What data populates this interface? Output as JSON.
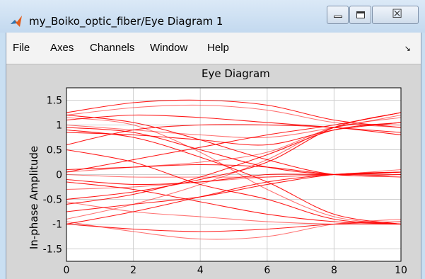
{
  "window": {
    "title": "my_Boiko_optic_fiber/Eye Diagram 1"
  },
  "icons": {
    "app": "matlab-logo-icon",
    "minimize": "minimize-icon",
    "maximize": "maximize-icon",
    "close": "close-icon",
    "dock": "dock-arrow-icon"
  },
  "controls": {
    "close_glyph": "☒"
  },
  "menu": {
    "items": [
      "File",
      "Axes",
      "Channels",
      "Window",
      "Help"
    ],
    "dock_glyph": "↘"
  },
  "chart_data": {
    "type": "line",
    "title": "Eye Diagram",
    "xlabel": "",
    "ylabel": "In-phase Amplitude",
    "xlim": [
      0,
      10
    ],
    "ylim": [
      -1.75,
      1.75
    ],
    "xticks": [
      "0",
      "2",
      "4",
      "6",
      "8",
      "10"
    ],
    "yticks": [
      "1.5",
      "1",
      "0.5",
      "0",
      "-0.5",
      "-1",
      "-1.5"
    ],
    "grid": true,
    "color": "#ff0000",
    "series": [
      {
        "x": [
          0,
          2,
          4,
          6,
          8,
          10
        ],
        "y": [
          1.2,
          1.35,
          1.4,
          1.3,
          1.05,
          0.95
        ]
      },
      {
        "x": [
          0,
          2,
          4,
          6,
          8,
          10
        ],
        "y": [
          1.25,
          1.45,
          1.5,
          1.4,
          1.1,
          0.95
        ]
      },
      {
        "x": [
          0,
          2,
          4,
          6,
          8,
          10
        ],
        "y": [
          1.1,
          1.2,
          1.15,
          1.05,
          0.95,
          0.85
        ]
      },
      {
        "x": [
          0,
          2,
          4,
          6,
          8,
          10
        ],
        "y": [
          1.0,
          0.9,
          0.8,
          0.75,
          0.95,
          1.2
        ]
      },
      {
        "x": [
          0,
          2,
          4,
          6,
          8,
          10
        ],
        "y": [
          0.95,
          0.85,
          0.5,
          0.15,
          0.0,
          0.05
        ]
      },
      {
        "x": [
          0,
          2,
          4,
          6,
          8,
          10
        ],
        "y": [
          0.85,
          0.8,
          0.7,
          0.6,
          0.9,
          1.05
        ]
      },
      {
        "x": [
          0,
          2,
          4,
          6,
          8,
          10
        ],
        "y": [
          0.05,
          0.15,
          0.25,
          0.45,
          0.95,
          1.15
        ]
      },
      {
        "x": [
          0,
          2,
          4,
          6,
          8,
          10
        ],
        "y": [
          0.05,
          0.3,
          0.55,
          0.8,
          1.0,
          1.25
        ]
      },
      {
        "x": [
          0,
          2,
          4,
          6,
          8,
          10
        ],
        "y": [
          0.1,
          0.15,
          0.2,
          0.15,
          0.0,
          -0.05
        ]
      },
      {
        "x": [
          0,
          2,
          4,
          6,
          8,
          10
        ],
        "y": [
          0.0,
          -0.05,
          -0.05,
          -0.05,
          0.0,
          0.0
        ]
      },
      {
        "x": [
          0,
          2,
          4,
          6,
          8,
          10
        ],
        "y": [
          -0.1,
          -0.2,
          -0.15,
          0.0,
          0.0,
          0.05
        ]
      },
      {
        "x": [
          0,
          2,
          4,
          6,
          8,
          10
        ],
        "y": [
          -0.15,
          -0.3,
          -0.55,
          -0.8,
          -0.95,
          -1.0
        ]
      },
      {
        "x": [
          0,
          2,
          4,
          6,
          8,
          10
        ],
        "y": [
          -0.3,
          -0.25,
          -0.15,
          -0.05,
          0.0,
          0.1
        ]
      },
      {
        "x": [
          0,
          2,
          4,
          6,
          8,
          10
        ],
        "y": [
          -0.5,
          -0.35,
          -0.1,
          0.25,
          0.95,
          1.25
        ]
      },
      {
        "x": [
          0,
          2,
          4,
          6,
          8,
          10
        ],
        "y": [
          -0.6,
          -0.4,
          -0.05,
          0.4,
          0.9,
          1.05
        ]
      },
      {
        "x": [
          0,
          2,
          4,
          6,
          8,
          10
        ],
        "y": [
          -0.9,
          -0.6,
          -0.2,
          0.3,
          0.95,
          1.0
        ]
      },
      {
        "x": [
          0,
          2,
          4,
          6,
          8,
          10
        ],
        "y": [
          -1.0,
          -0.75,
          -0.45,
          -0.15,
          0.0,
          0.05
        ]
      },
      {
        "x": [
          0,
          2,
          4,
          6,
          8,
          10
        ],
        "y": [
          -1.0,
          -1.1,
          -1.15,
          -1.1,
          -1.0,
          -0.95
        ]
      },
      {
        "x": [
          0,
          2,
          4,
          6,
          8,
          10
        ],
        "y": [
          -0.95,
          -1.15,
          -1.3,
          -1.25,
          -1.0,
          -0.9
        ]
      },
      {
        "x": [
          0,
          2,
          4,
          6,
          8,
          10
        ],
        "y": [
          -0.75,
          -0.6,
          -0.45,
          -0.2,
          0.0,
          0.05
        ]
      },
      {
        "x": [
          0,
          2,
          4,
          6,
          8,
          10
        ],
        "y": [
          1.2,
          1.05,
          0.7,
          0.3,
          0.0,
          0.0
        ]
      },
      {
        "x": [
          0,
          2,
          4,
          6,
          8,
          10
        ],
        "y": [
          1.15,
          1.0,
          0.45,
          -0.3,
          -0.85,
          -1.0
        ]
      },
      {
        "x": [
          0,
          2,
          4,
          6,
          8,
          10
        ],
        "y": [
          0.9,
          0.75,
          0.35,
          -0.15,
          -0.8,
          -1.0
        ]
      },
      {
        "x": [
          0,
          2,
          4,
          6,
          8,
          10
        ],
        "y": [
          0.5,
          0.25,
          -0.2,
          -0.5,
          -0.9,
          -1.0
        ]
      },
      {
        "x": [
          0,
          2,
          4,
          6,
          8,
          10
        ],
        "y": [
          -0.55,
          -0.75,
          -0.85,
          -0.95,
          -1.0,
          -1.0
        ]
      },
      {
        "x": [
          0,
          2,
          4,
          6,
          8,
          10
        ],
        "y": [
          0.6,
          0.9,
          1.0,
          1.0,
          0.95,
          0.8
        ]
      }
    ]
  }
}
